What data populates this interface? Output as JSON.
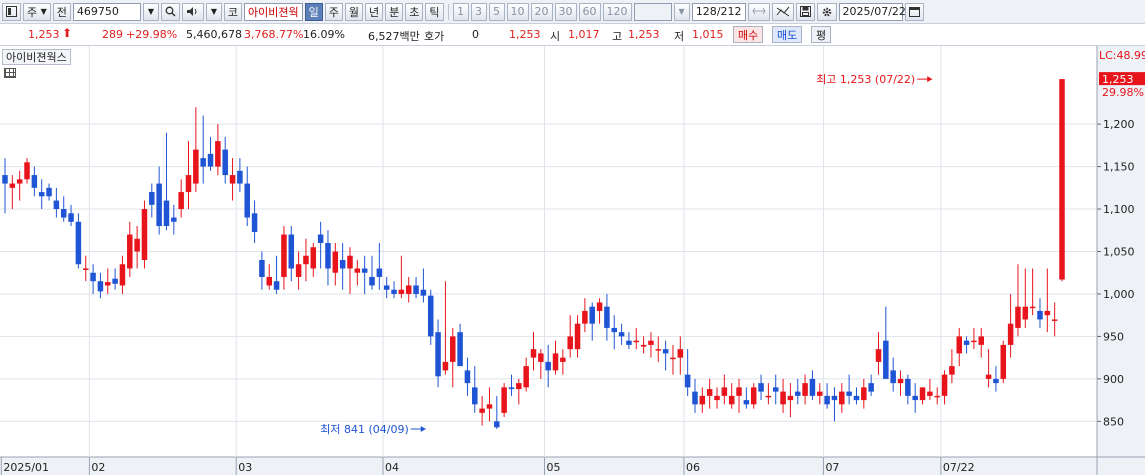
{
  "toolbar": {
    "market_label": "주",
    "prev_label": "전",
    "code": "469750",
    "code_tag": "코",
    "stock_name": "아이비젼웍",
    "periods": [
      "일",
      "주",
      "월",
      "년",
      "분",
      "초",
      "틱"
    ],
    "active_period": "일",
    "intervals": [
      "1",
      "3",
      "5",
      "10",
      "20",
      "30",
      "60",
      "120"
    ],
    "count": "128",
    "total": "/212",
    "date": "2025/07/22"
  },
  "quote": {
    "price": "1,253",
    "change": "289",
    "change_pct": "+29.98%",
    "volume": "5,460,678",
    "volume_pct": "3,768.77%",
    "turnover_pct": "16.09%",
    "amount": "6,527백만",
    "bid_label": "호가",
    "bid_value": "0",
    "bid_price": "1,253",
    "open_label": "시",
    "open": "1,017",
    "high_label": "고",
    "high": "1,253",
    "low_label": "저",
    "low": "1,015",
    "buy_label": "매수",
    "sell_label": "매도",
    "eval_label": "평"
  },
  "chart_label": "아이비젼웍스",
  "colors": {
    "up": "#e8141b",
    "down": "#1f55d4",
    "grid": "#dfe3ea",
    "axis_bg": "#eef1f6"
  },
  "chart_data": {
    "type": "candlestick",
    "title": "아이비젼웍스",
    "y_ticks": [
      850,
      900,
      950,
      1000,
      1050,
      1100,
      1150,
      1200
    ],
    "y_tick_labels": [
      "850",
      "900",
      "950",
      "1,000",
      "1,050",
      "1,100",
      "1,150",
      "1,200"
    ],
    "ylim": [
      808,
      1292
    ],
    "x_labels": [
      {
        "i": 0,
        "t": "2025/01"
      },
      {
        "i": 12,
        "t": "02"
      },
      {
        "i": 32,
        "t": "03"
      },
      {
        "i": 52,
        "t": "04"
      },
      {
        "i": 74,
        "t": "05"
      },
      {
        "i": 93,
        "t": "06"
      },
      {
        "i": 112,
        "t": "07"
      },
      {
        "i": 128,
        "t": "07/22"
      }
    ],
    "limit_label": "LC:48.99",
    "last_price_label": "1,253",
    "last_pct_label": "29.98%",
    "annotations": [
      {
        "text": "최고 1,253 (07/22)",
        "index": 127,
        "value": 1253,
        "kind": "high"
      },
      {
        "text": "최저 841 (04/09)",
        "index": 58,
        "value": 841,
        "kind": "low"
      }
    ],
    "candles": [
      [
        1140,
        1160,
        1095,
        1130
      ],
      [
        1125,
        1140,
        1100,
        1130
      ],
      [
        1130,
        1145,
        1110,
        1135
      ],
      [
        1135,
        1160,
        1130,
        1155
      ],
      [
        1140,
        1150,
        1115,
        1125
      ],
      [
        1120,
        1135,
        1100,
        1115
      ],
      [
        1125,
        1130,
        1110,
        1115
      ],
      [
        1110,
        1125,
        1090,
        1100
      ],
      [
        1100,
        1115,
        1085,
        1090
      ],
      [
        1095,
        1105,
        1080,
        1085
      ],
      [
        1085,
        1095,
        1030,
        1035
      ],
      [
        1030,
        1045,
        1015,
        1030
      ],
      [
        1025,
        1035,
        1000,
        1015
      ],
      [
        1015,
        1025,
        995,
        1003
      ],
      [
        1010,
        1030,
        1000,
        1014
      ],
      [
        1018,
        1030,
        1005,
        1012
      ],
      [
        1010,
        1045,
        1000,
        1035
      ],
      [
        1030,
        1085,
        1020,
        1070
      ],
      [
        1050,
        1080,
        1030,
        1065
      ],
      [
        1040,
        1110,
        1030,
        1100
      ],
      [
        1120,
        1130,
        1090,
        1105
      ],
      [
        1130,
        1150,
        1070,
        1080
      ],
      [
        1110,
        1190,
        1075,
        1080
      ],
      [
        1090,
        1105,
        1070,
        1085
      ],
      [
        1100,
        1135,
        1090,
        1120
      ],
      [
        1120,
        1180,
        1100,
        1140
      ],
      [
        1130,
        1220,
        1120,
        1170
      ],
      [
        1160,
        1210,
        1130,
        1150
      ],
      [
        1165,
        1185,
        1145,
        1150
      ],
      [
        1150,
        1200,
        1140,
        1180
      ],
      [
        1170,
        1185,
        1130,
        1140
      ],
      [
        1130,
        1160,
        1110,
        1140
      ],
      [
        1145,
        1160,
        1120,
        1130
      ],
      [
        1130,
        1150,
        1080,
        1090
      ],
      [
        1095,
        1110,
        1060,
        1073
      ],
      [
        1040,
        1050,
        1005,
        1020
      ],
      [
        1010,
        1035,
        1005,
        1020
      ],
      [
        1015,
        1045,
        1000,
        1005
      ],
      [
        1020,
        1080,
        1005,
        1070
      ],
      [
        1070,
        1080,
        1015,
        1030
      ],
      [
        1020,
        1050,
        1005,
        1035
      ],
      [
        1035,
        1065,
        1015,
        1045
      ],
      [
        1030,
        1060,
        1020,
        1055
      ],
      [
        1070,
        1085,
        1030,
        1060
      ],
      [
        1060,
        1075,
        1010,
        1030
      ],
      [
        1025,
        1060,
        1010,
        1050
      ],
      [
        1040,
        1060,
        1005,
        1030
      ],
      [
        1030,
        1055,
        1000,
        1045
      ],
      [
        1025,
        1040,
        1010,
        1030
      ],
      [
        1030,
        1045,
        1000,
        1025
      ],
      [
        1020,
        1045,
        1005,
        1010
      ],
      [
        1030,
        1060,
        1005,
        1020
      ],
      [
        1010,
        1020,
        995,
        1005
      ],
      [
        1005,
        1015,
        995,
        1000
      ],
      [
        1000,
        1045,
        995,
        1005
      ],
      [
        1000,
        1020,
        990,
        1010
      ],
      [
        1010,
        1020,
        995,
        1000
      ],
      [
        1005,
        1030,
        990,
        998
      ],
      [
        998,
        1005,
        940,
        950
      ],
      [
        955,
        970,
        890,
        903
      ],
      [
        910,
        1015,
        905,
        920
      ],
      [
        920,
        960,
        890,
        950
      ],
      [
        955,
        965,
        935,
        915
      ],
      [
        910,
        925,
        880,
        895
      ],
      [
        890,
        915,
        860,
        870
      ],
      [
        860,
        880,
        845,
        865
      ],
      [
        865,
        890,
        850,
        870
      ],
      [
        850,
        880,
        841,
        843
      ],
      [
        860,
        895,
        855,
        890
      ],
      [
        890,
        905,
        880,
        888
      ],
      [
        888,
        900,
        870,
        895
      ],
      [
        890,
        925,
        885,
        915
      ],
      [
        925,
        955,
        910,
        935
      ],
      [
        920,
        935,
        900,
        930
      ],
      [
        920,
        940,
        890,
        910
      ],
      [
        910,
        945,
        905,
        930
      ],
      [
        920,
        935,
        905,
        925
      ],
      [
        935,
        975,
        925,
        950
      ],
      [
        935,
        975,
        925,
        965
      ],
      [
        965,
        995,
        955,
        980
      ],
      [
        985,
        990,
        945,
        965
      ],
      [
        980,
        995,
        965,
        990
      ],
      [
        985,
        1000,
        945,
        960
      ],
      [
        960,
        975,
        935,
        955
      ],
      [
        955,
        965,
        940,
        950
      ],
      [
        945,
        955,
        935,
        940
      ],
      [
        945,
        960,
        935,
        945
      ],
      [
        938,
        950,
        930,
        940
      ],
      [
        940,
        955,
        925,
        945
      ],
      [
        935,
        950,
        920,
        935
      ],
      [
        935,
        945,
        910,
        930
      ],
      [
        925,
        940,
        905,
        925
      ],
      [
        925,
        950,
        905,
        935
      ],
      [
        905,
        935,
        880,
        890
      ],
      [
        885,
        900,
        860,
        870
      ],
      [
        870,
        890,
        860,
        880
      ],
      [
        880,
        900,
        865,
        888
      ],
      [
        875,
        890,
        865,
        880
      ],
      [
        880,
        905,
        870,
        890
      ],
      [
        870,
        895,
        865,
        880
      ],
      [
        880,
        900,
        860,
        890
      ],
      [
        875,
        890,
        865,
        870
      ],
      [
        870,
        895,
        865,
        890
      ],
      [
        895,
        905,
        875,
        885
      ],
      [
        880,
        895,
        870,
        880
      ],
      [
        890,
        905,
        870,
        885
      ],
      [
        870,
        900,
        860,
        885
      ],
      [
        875,
        895,
        855,
        880
      ],
      [
        885,
        900,
        870,
        880
      ],
      [
        880,
        905,
        870,
        895
      ],
      [
        900,
        910,
        875,
        880
      ],
      [
        880,
        895,
        870,
        885
      ],
      [
        880,
        895,
        865,
        870
      ],
      [
        880,
        890,
        850,
        875
      ],
      [
        870,
        895,
        860,
        885
      ],
      [
        885,
        905,
        870,
        880
      ],
      [
        880,
        890,
        870,
        875
      ],
      [
        875,
        900,
        865,
        890
      ],
      [
        895,
        905,
        880,
        885
      ],
      [
        920,
        955,
        905,
        935
      ],
      [
        945,
        985,
        900,
        900
      ],
      [
        910,
        925,
        885,
        895
      ],
      [
        895,
        910,
        880,
        900
      ],
      [
        900,
        905,
        870,
        880
      ],
      [
        880,
        895,
        860,
        875
      ],
      [
        875,
        890,
        870,
        890
      ],
      [
        880,
        900,
        875,
        885
      ],
      [
        880,
        890,
        870,
        880
      ],
      [
        880,
        910,
        870,
        905
      ],
      [
        905,
        935,
        895,
        915
      ],
      [
        930,
        960,
        915,
        950
      ],
      [
        945,
        950,
        930,
        940
      ],
      [
        945,
        960,
        935,
        945
      ],
      [
        940,
        960,
        925,
        950
      ],
      [
        900,
        935,
        890,
        905
      ],
      [
        900,
        915,
        885,
        895
      ],
      [
        900,
        945,
        895,
        940
      ],
      [
        940,
        1000,
        925,
        965
      ],
      [
        960,
        1035,
        950,
        985
      ],
      [
        970,
        1030,
        960,
        985
      ],
      [
        985,
        1030,
        975,
        985
      ],
      [
        980,
        995,
        960,
        970
      ],
      [
        975,
        1030,
        955,
        980
      ],
      [
        970,
        990,
        950,
        970
      ],
      [
        1017,
        1253,
        1015,
        1253
      ]
    ]
  }
}
